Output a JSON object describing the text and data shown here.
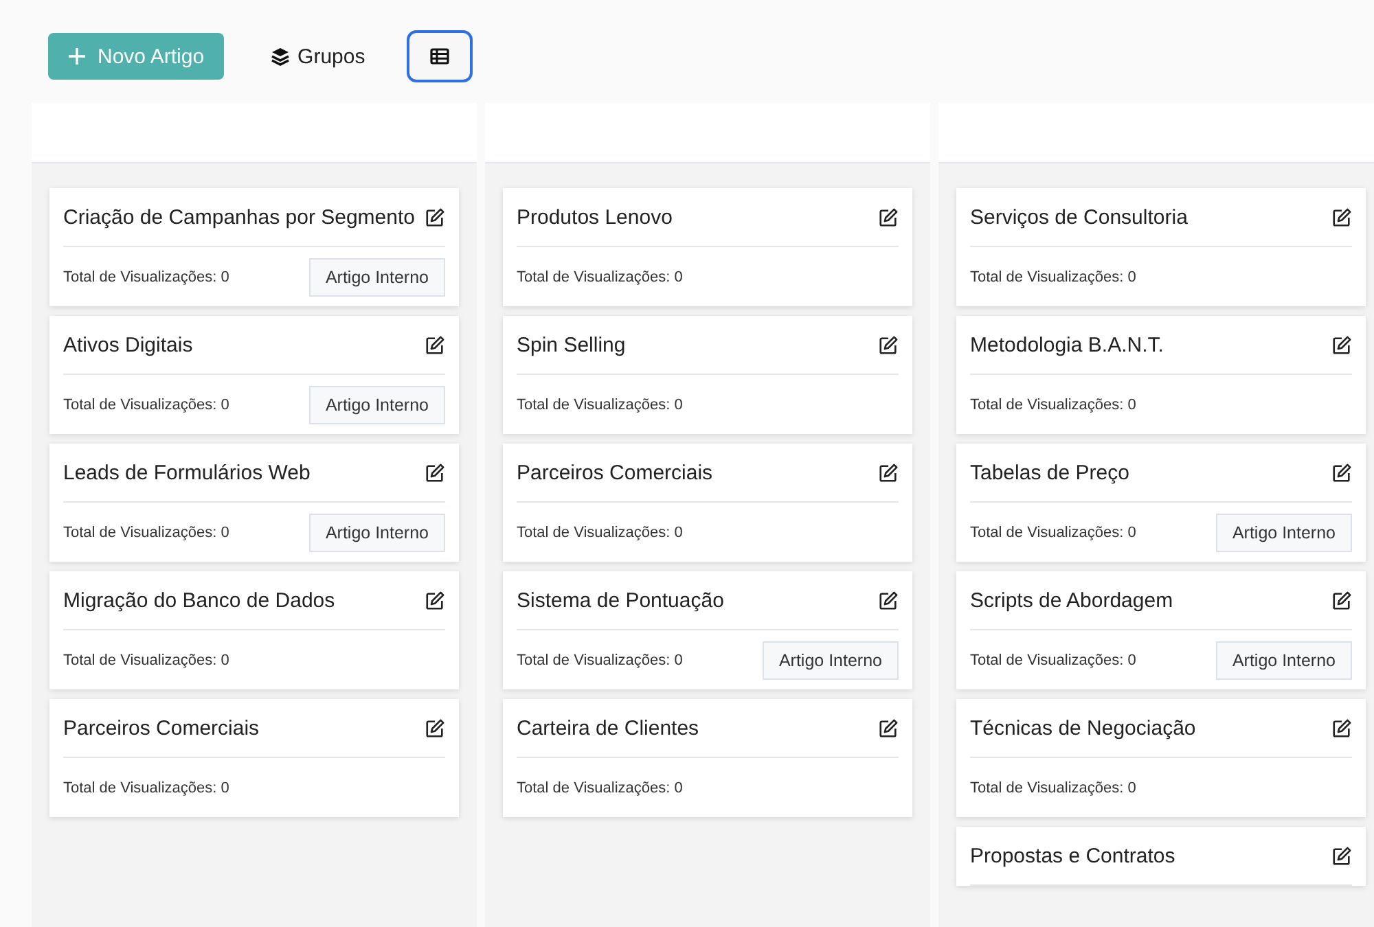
{
  "toolbar": {
    "new_button": "Novo Artigo",
    "groups_button": "Grupos",
    "list_view_toggle": {
      "selected": true
    }
  },
  "columns": [
    {
      "cards": [
        {
          "title": "Criação de Campanhas por Segmento",
          "views": "Total de Visualizações: 0",
          "tag": "Artigo Interno"
        },
        {
          "title": "Ativos Digitais",
          "views": "Total de Visualizações: 0",
          "tag": "Artigo Interno"
        },
        {
          "title": "Leads de Formulários Web",
          "views": "Total de Visualizações: 0",
          "tag": "Artigo Interno"
        },
        {
          "title": "Migração do Banco de Dados",
          "views": "Total de Visualizações: 0"
        },
        {
          "title": "Parceiros Comerciais",
          "views": "Total de Visualizações: 0"
        }
      ]
    },
    {
      "cards": [
        {
          "title": "Produtos Lenovo",
          "views": "Total de Visualizações: 0"
        },
        {
          "title": "Spin Selling",
          "views": "Total de Visualizações: 0"
        },
        {
          "title": "Parceiros Comerciais",
          "views": "Total de Visualizações: 0"
        },
        {
          "title": "Sistema de Pontuação",
          "views": "Total de Visualizações: 0",
          "tag": "Artigo Interno"
        },
        {
          "title": "Carteira de Clientes",
          "views": "Total de Visualizações: 0"
        }
      ]
    },
    {
      "cards": [
        {
          "title": "Serviços de Consultoria",
          "views": "Total de Visualizações: 0"
        },
        {
          "title": "Metodologia B.A.N.T.",
          "views": "Total de Visualizações: 0"
        },
        {
          "title": "Tabelas de Preço",
          "views": "Total de Visualizações: 0",
          "tag": "Artigo Interno"
        },
        {
          "title": "Scripts de Abordagem",
          "views": "Total de Visualizações: 0",
          "tag": "Artigo Interno"
        },
        {
          "title": "Técnicas de Negociação",
          "views": "Total de Visualizações: 0"
        },
        {
          "title": "Propostas e Contratos"
        }
      ]
    }
  ]
}
